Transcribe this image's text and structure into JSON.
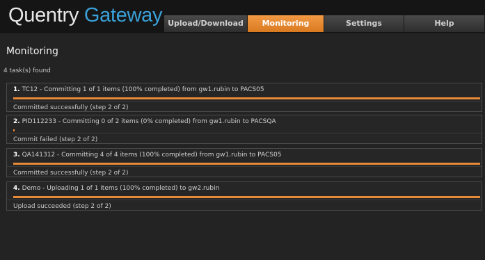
{
  "app": {
    "title_part1": "Quentry",
    "title_part2": "Gateway"
  },
  "nav": {
    "tabs": [
      {
        "label": "Upload/Download",
        "active": false
      },
      {
        "label": "Monitoring",
        "active": true
      },
      {
        "label": "Settings",
        "active": false
      },
      {
        "label": "Help",
        "active": false
      }
    ]
  },
  "page": {
    "title": "Monitoring",
    "count": "4 task(s) found"
  },
  "tasks": [
    {
      "number": "1.",
      "text": "TC12 - Committing 1 of 1 items (100% completed) from gw1.rubin to PACS05",
      "progress": 1.0,
      "status": "Committed successfully (step 2 of 2)"
    },
    {
      "number": "2.",
      "text": "PID112233 - Committing 0 of 2 items (0% completed) from gw1.rubin to PACSQA",
      "progress": 0.0,
      "status": "Commit failed (step 2 of 2)"
    },
    {
      "number": "3.",
      "text": "QA141312 - Committing 4 of 4 items (100% completed) from gw1.rubin to PACS05",
      "progress": 1.0,
      "status": "Committed successfully (step 2 of 2)"
    },
    {
      "number": "4.",
      "text": "Demo - Uploading 1 of 1 items (100% completed) to gw2.rubin",
      "progress": 1.0,
      "status": "Upload succeeded (step 2 of 2)"
    }
  ],
  "colors": {
    "accent": "#e8893a",
    "logo_blue": "#3aa0d8"
  }
}
